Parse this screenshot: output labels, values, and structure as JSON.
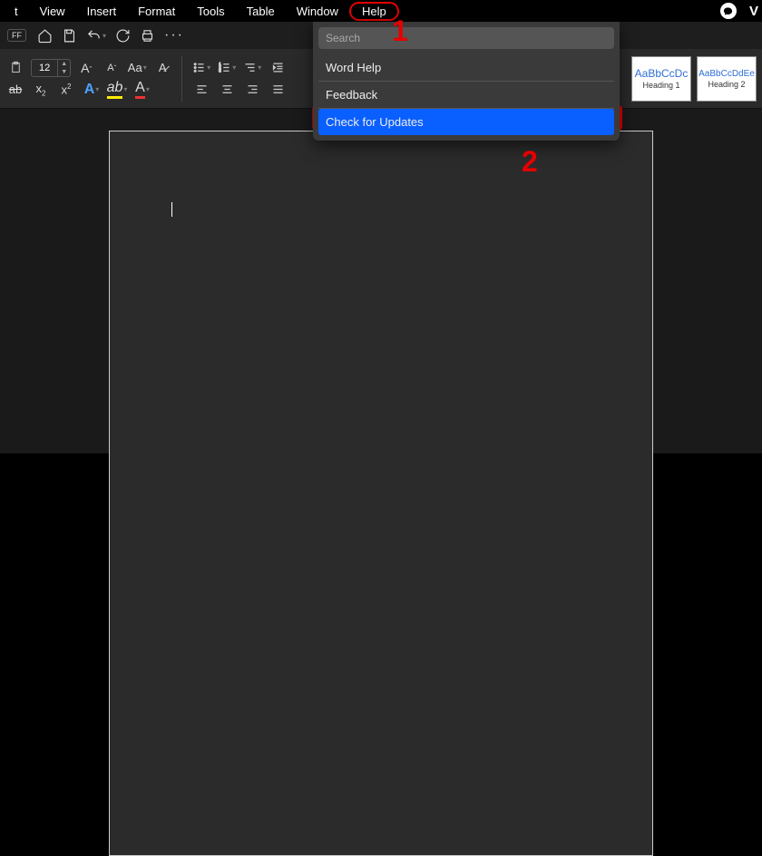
{
  "menubar": {
    "items": [
      "t",
      "View",
      "Insert",
      "Format",
      "Tools",
      "Table",
      "Window",
      "Help"
    ],
    "right_label": "V"
  },
  "toolbar1": {
    "ff": "FF"
  },
  "ribbon": {
    "font_size": "12",
    "aa_label": "Aa",
    "styles": [
      {
        "sample": "AaBbCcDc",
        "label": "Heading 1"
      },
      {
        "sample": "AaBbCcDdEe",
        "label": "Heading 2"
      }
    ]
  },
  "help_menu": {
    "search_placeholder": "Search",
    "items": [
      "Word Help",
      "Feedback",
      "Check for Updates"
    ]
  },
  "annotations": {
    "one": "1",
    "two": "2"
  }
}
